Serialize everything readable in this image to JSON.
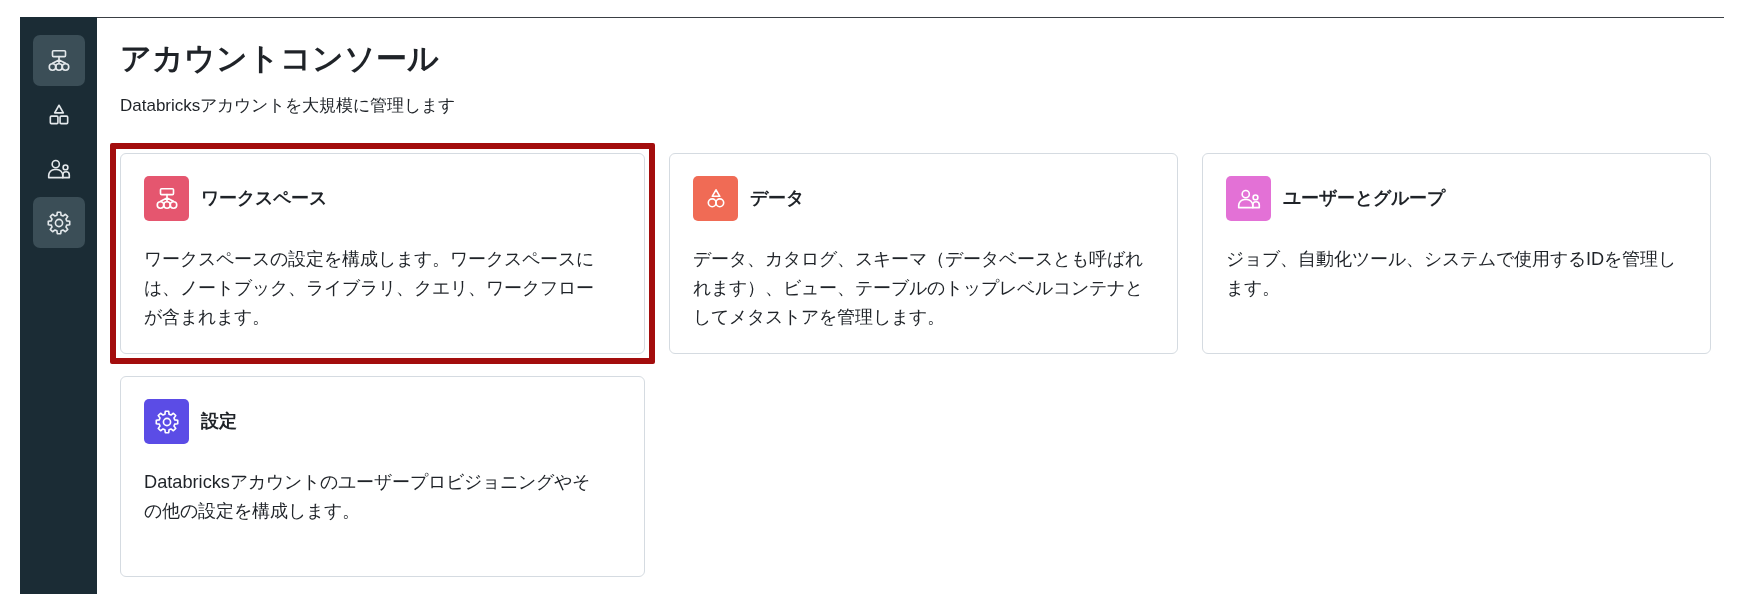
{
  "sidebar": {
    "items": [
      {
        "kind": "workspace",
        "selected": true
      },
      {
        "kind": "data",
        "selected": false
      },
      {
        "kind": "users",
        "selected": false
      },
      {
        "kind": "settings",
        "selected": true
      }
    ]
  },
  "header": {
    "title": "アカウントコンソール",
    "subtitle": "Databricksアカウントを大規模に管理します"
  },
  "cards": [
    {
      "kind": "workspace",
      "color": "#e5566f",
      "title": "ワークスペース",
      "description": "ワークスペースの設定を構成します。ワークスペースには、ノートブック、ライブラリ、クエリ、ワークフローが含まれます。",
      "highlighted": true
    },
    {
      "kind": "data",
      "color": "#f06b55",
      "title": "データ",
      "description": "データ、カタログ、スキーマ（データベースとも呼ばれれます）、ビュー、テーブルのトップレベルコンテナとしてメタストアを管理します。",
      "highlighted": false
    },
    {
      "kind": "users",
      "color": "#e371d6",
      "title": "ユーザーとグループ",
      "description": "ジョブ、自動化ツール、システムで使用するIDを管理します。",
      "highlighted": false
    },
    {
      "kind": "settings",
      "color": "#5b4ce6",
      "title": "設定",
      "description": "Databricksアカウントのユーザープロビジョニングやその他の設定を構成します。",
      "highlighted": false
    }
  ]
}
